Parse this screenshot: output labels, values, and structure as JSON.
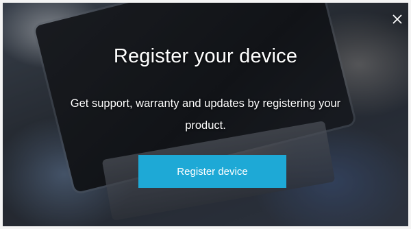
{
  "modal": {
    "title": "Register your device",
    "description": "Get support, warranty and updates by registering your product.",
    "button_label": "Register device",
    "close_icon": "close-icon"
  },
  "colors": {
    "accent": "#1ea9d6",
    "text": "#ffffff"
  }
}
